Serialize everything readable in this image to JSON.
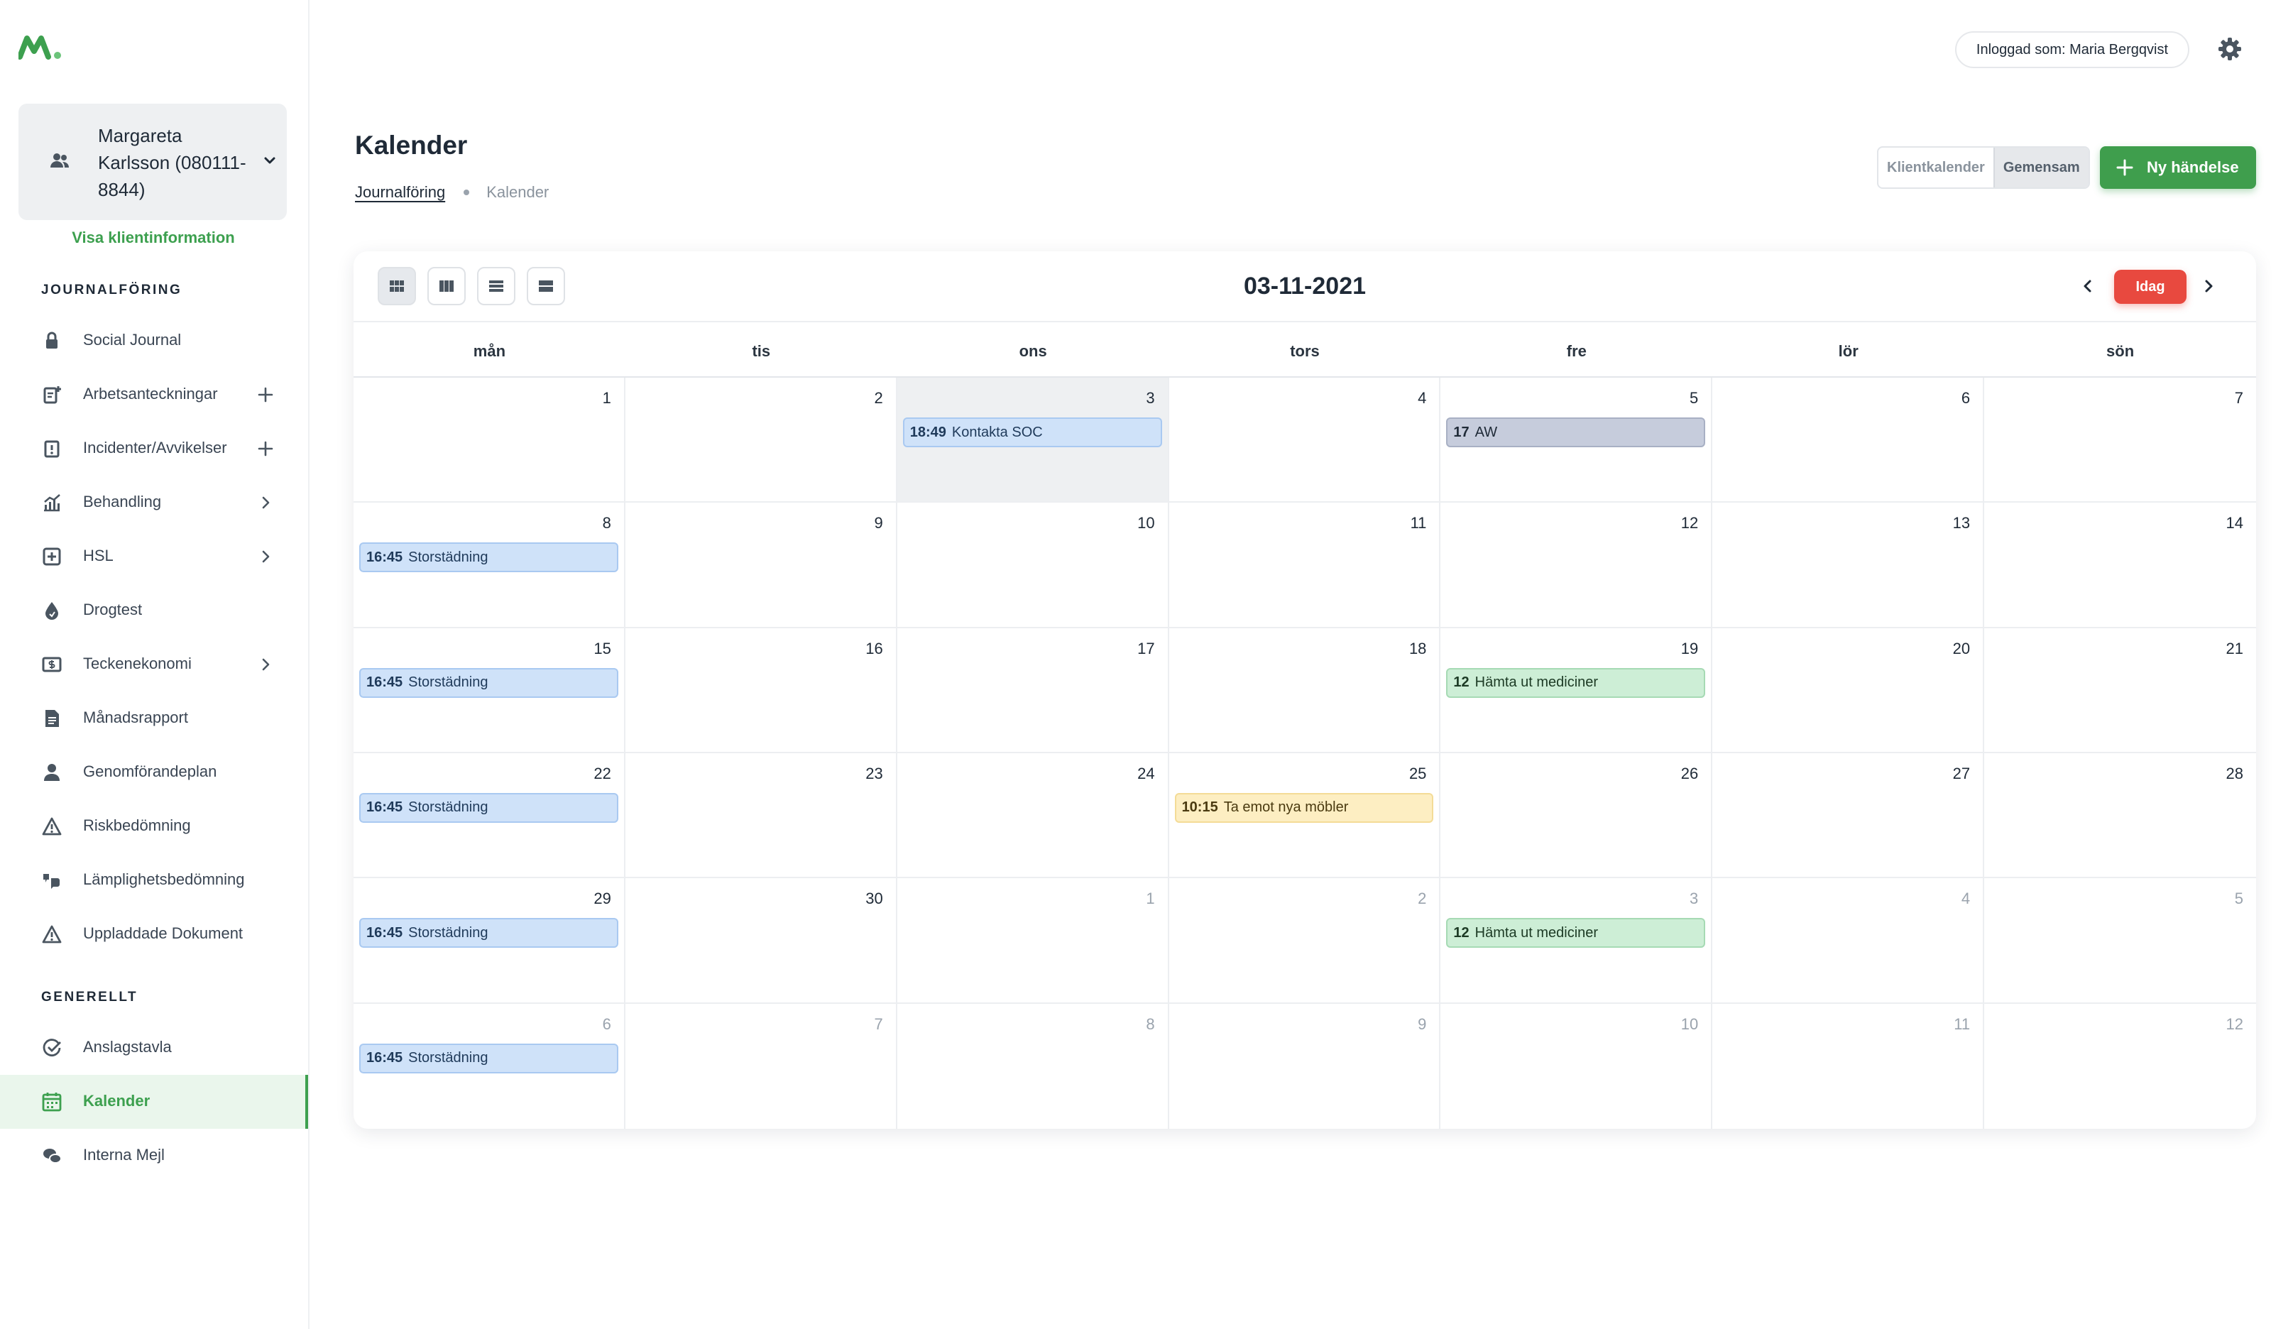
{
  "user": {
    "logged_in_label": "Inloggad som: Maria Bergqvist"
  },
  "client": {
    "name": "Margareta Karlsson (080111-8844)",
    "link": "Visa klientinformation"
  },
  "sidebar": {
    "sections": [
      {
        "title": "JOURNALFÖRING",
        "items": [
          {
            "label": "Social Journal",
            "icon": "lock-icon"
          },
          {
            "label": "Arbetsanteckningar",
            "icon": "note-add-icon",
            "action": "plus"
          },
          {
            "label": "Incidenter/Avvikelser",
            "icon": "incident-icon",
            "action": "plus"
          },
          {
            "label": "Behandling",
            "icon": "chart-icon",
            "action": "chevron"
          },
          {
            "label": "HSL",
            "icon": "medical-cross-icon",
            "action": "chevron"
          },
          {
            "label": "Drogtest",
            "icon": "drop-icon"
          },
          {
            "label": "Teckenekonomi",
            "icon": "money-icon",
            "action": "chevron"
          },
          {
            "label": "Månadsrapport",
            "icon": "document-icon"
          },
          {
            "label": "Genomförandeplan",
            "icon": "person-icon"
          },
          {
            "label": "Riskbedömning",
            "icon": "warning-icon"
          },
          {
            "label": "Lämplighetsbedömning",
            "icon": "thumbs-icon"
          },
          {
            "label": "Uppladdade Dokument",
            "icon": "upload-warning-icon"
          }
        ]
      },
      {
        "title": "GENERELLT",
        "items": [
          {
            "label": "Anslagstavla",
            "icon": "check-circle-icon"
          },
          {
            "label": "Kalender",
            "icon": "calendar-icon",
            "active": true
          },
          {
            "label": "Interna Mejl",
            "icon": "chat-icon"
          }
        ]
      }
    ]
  },
  "header": {
    "title": "Kalender",
    "breadcrumb": [
      "Journalföring",
      "Kalender"
    ],
    "view_toggle": [
      "Klientkalender",
      "Gemensam"
    ],
    "new_event_label": "Ny händelse"
  },
  "calendar": {
    "current_date": "03-11-2021",
    "today_label": "Idag",
    "weekdays": [
      "mån",
      "tis",
      "ons",
      "tors",
      "fre",
      "lör",
      "sön"
    ],
    "today_index": 2,
    "days": [
      {
        "n": "1"
      },
      {
        "n": "2"
      },
      {
        "n": "3",
        "events": [
          {
            "time": "18:49",
            "title": "Kontakta SOC",
            "color": "blue"
          }
        ]
      },
      {
        "n": "4"
      },
      {
        "n": "5",
        "events": [
          {
            "time": "17",
            "title": "AW",
            "color": "gray"
          }
        ]
      },
      {
        "n": "6"
      },
      {
        "n": "7"
      },
      {
        "n": "8",
        "events": [
          {
            "time": "16:45",
            "title": "Storstädning",
            "color": "blue"
          }
        ]
      },
      {
        "n": "9"
      },
      {
        "n": "10"
      },
      {
        "n": "11"
      },
      {
        "n": "12"
      },
      {
        "n": "13"
      },
      {
        "n": "14"
      },
      {
        "n": "15",
        "events": [
          {
            "time": "16:45",
            "title": "Storstädning",
            "color": "blue"
          }
        ]
      },
      {
        "n": "16"
      },
      {
        "n": "17"
      },
      {
        "n": "18"
      },
      {
        "n": "19",
        "events": [
          {
            "time": "12",
            "title": "Hämta ut mediciner",
            "color": "green"
          }
        ]
      },
      {
        "n": "20"
      },
      {
        "n": "21"
      },
      {
        "n": "22",
        "events": [
          {
            "time": "16:45",
            "title": "Storstädning",
            "color": "blue"
          }
        ]
      },
      {
        "n": "23"
      },
      {
        "n": "24"
      },
      {
        "n": "25",
        "events": [
          {
            "time": "10:15",
            "title": "Ta emot nya möbler",
            "color": "yellow"
          }
        ]
      },
      {
        "n": "26"
      },
      {
        "n": "27"
      },
      {
        "n": "28"
      },
      {
        "n": "29",
        "events": [
          {
            "time": "16:45",
            "title": "Storstädning",
            "color": "blue"
          }
        ]
      },
      {
        "n": "30"
      },
      {
        "n": "1",
        "other": true
      },
      {
        "n": "2",
        "other": true
      },
      {
        "n": "3",
        "other": true,
        "events": [
          {
            "time": "12",
            "title": "Hämta ut mediciner",
            "color": "green"
          }
        ]
      },
      {
        "n": "4",
        "other": true
      },
      {
        "n": "5",
        "other": true
      },
      {
        "n": "6",
        "other": true,
        "events": [
          {
            "time": "16:45",
            "title": "Storstädning",
            "color": "blue"
          }
        ]
      },
      {
        "n": "7",
        "other": true
      },
      {
        "n": "8",
        "other": true
      },
      {
        "n": "9",
        "other": true
      },
      {
        "n": "10",
        "other": true
      },
      {
        "n": "11",
        "other": true
      },
      {
        "n": "12",
        "other": true
      }
    ]
  },
  "colors": {
    "brand_green": "#3da04f",
    "today_red": "#e8493f",
    "event_blue": "#cfe2f9",
    "event_gray": "#c6ccdc",
    "event_green": "#cdeed6",
    "event_yellow": "#fdeec2"
  }
}
